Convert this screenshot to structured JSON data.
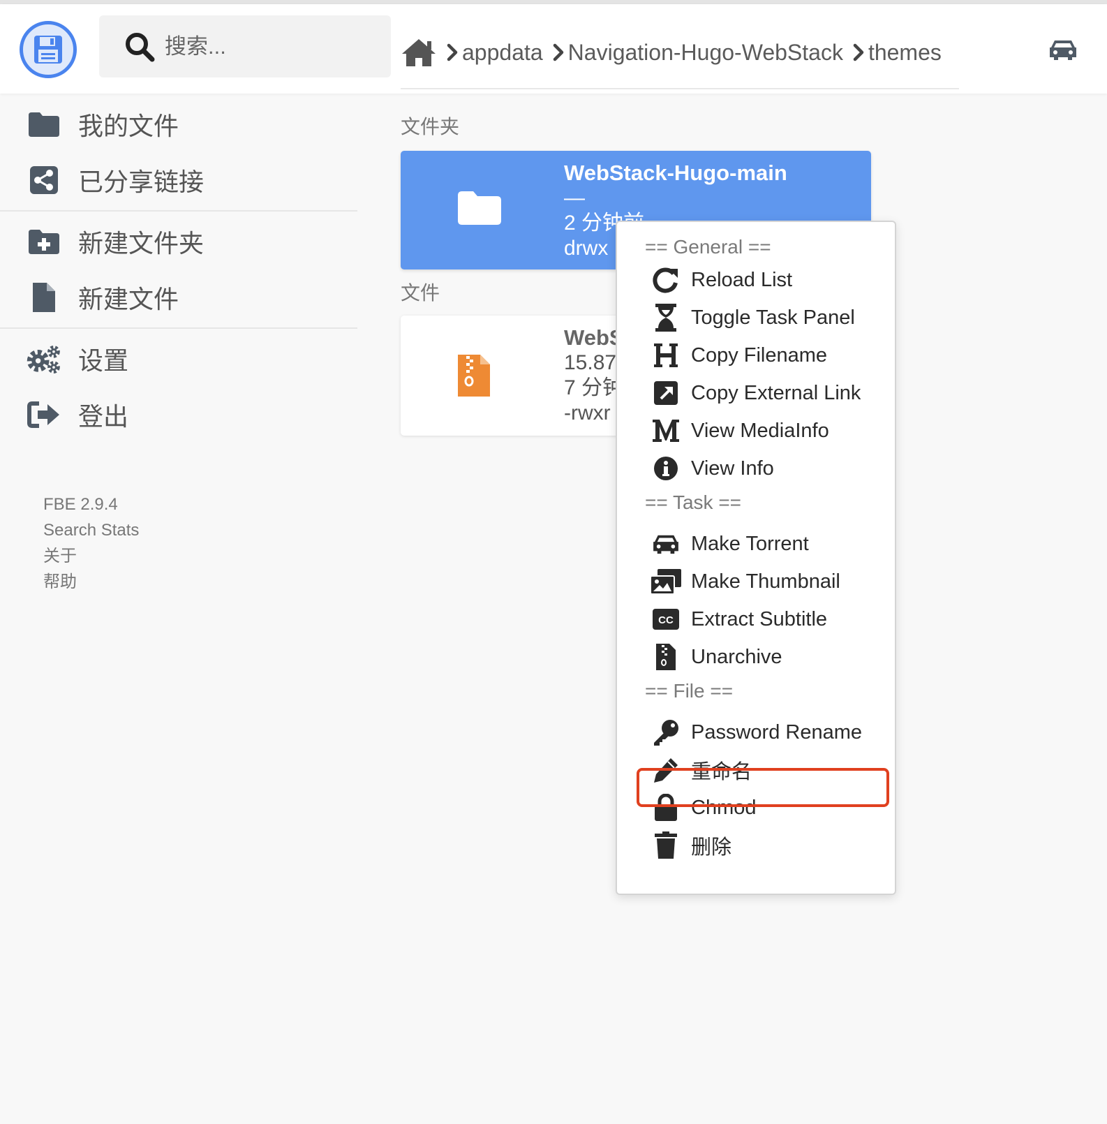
{
  "header": {
    "search_placeholder": "搜索...",
    "breadcrumb": [
      "appdata",
      "Navigation-Hugo-WebStack",
      "themes"
    ]
  },
  "sidebar": {
    "items": [
      {
        "label": "我的文件",
        "icon": "folder-icon"
      },
      {
        "label": "已分享链接",
        "icon": "share-icon"
      },
      {
        "label": "新建文件夹",
        "icon": "folder-plus-icon"
      },
      {
        "label": "新建文件",
        "icon": "file-icon"
      },
      {
        "label": "设置",
        "icon": "cogs-icon"
      },
      {
        "label": "登出",
        "icon": "sign-out-icon"
      }
    ],
    "footer": [
      "FBE 2.9.4",
      "Search Stats",
      "关于",
      "帮助"
    ]
  },
  "main": {
    "folders_title": "文件夹",
    "files_title": "文件",
    "folder": {
      "name": "WebStack-Hugo-main",
      "size": "—",
      "modified": "2 分钟前",
      "perms": "drwx"
    },
    "file": {
      "name": "WebS",
      "size": "15.87",
      "modified": "7 分钟",
      "perms": "-rwxr"
    }
  },
  "context_menu": {
    "general_header": "== General ==",
    "general": [
      {
        "label": "Reload List",
        "icon": "reload-icon"
      },
      {
        "label": "Toggle Task Panel",
        "icon": "hourglass-icon"
      },
      {
        "label": "Copy Filename",
        "icon": "heading-icon"
      },
      {
        "label": "Copy External Link",
        "icon": "external-link-icon"
      },
      {
        "label": "View MediaInfo",
        "icon": "m-icon"
      },
      {
        "label": "View Info",
        "icon": "info-icon"
      }
    ],
    "task_header": "== Task ==",
    "task": [
      {
        "label": "Make Torrent",
        "icon": "car-icon"
      },
      {
        "label": "Make Thumbnail",
        "icon": "images-icon"
      },
      {
        "label": "Extract Subtitle",
        "icon": "cc-icon"
      },
      {
        "label": "Unarchive",
        "icon": "file-archive-icon"
      }
    ],
    "file_header": "== File ==",
    "file": [
      {
        "label": "Password Rename",
        "icon": "key-icon"
      },
      {
        "label": "重命名",
        "icon": "pencil-icon"
      },
      {
        "label": "Chmod",
        "icon": "lock-icon"
      },
      {
        "label": "删除",
        "icon": "trash-icon"
      }
    ]
  },
  "colors": {
    "accent": "#5f97ee",
    "icon_gray": "#4f5a66",
    "highlight": "#e0401f",
    "archive_orange": "#ee8a34"
  }
}
